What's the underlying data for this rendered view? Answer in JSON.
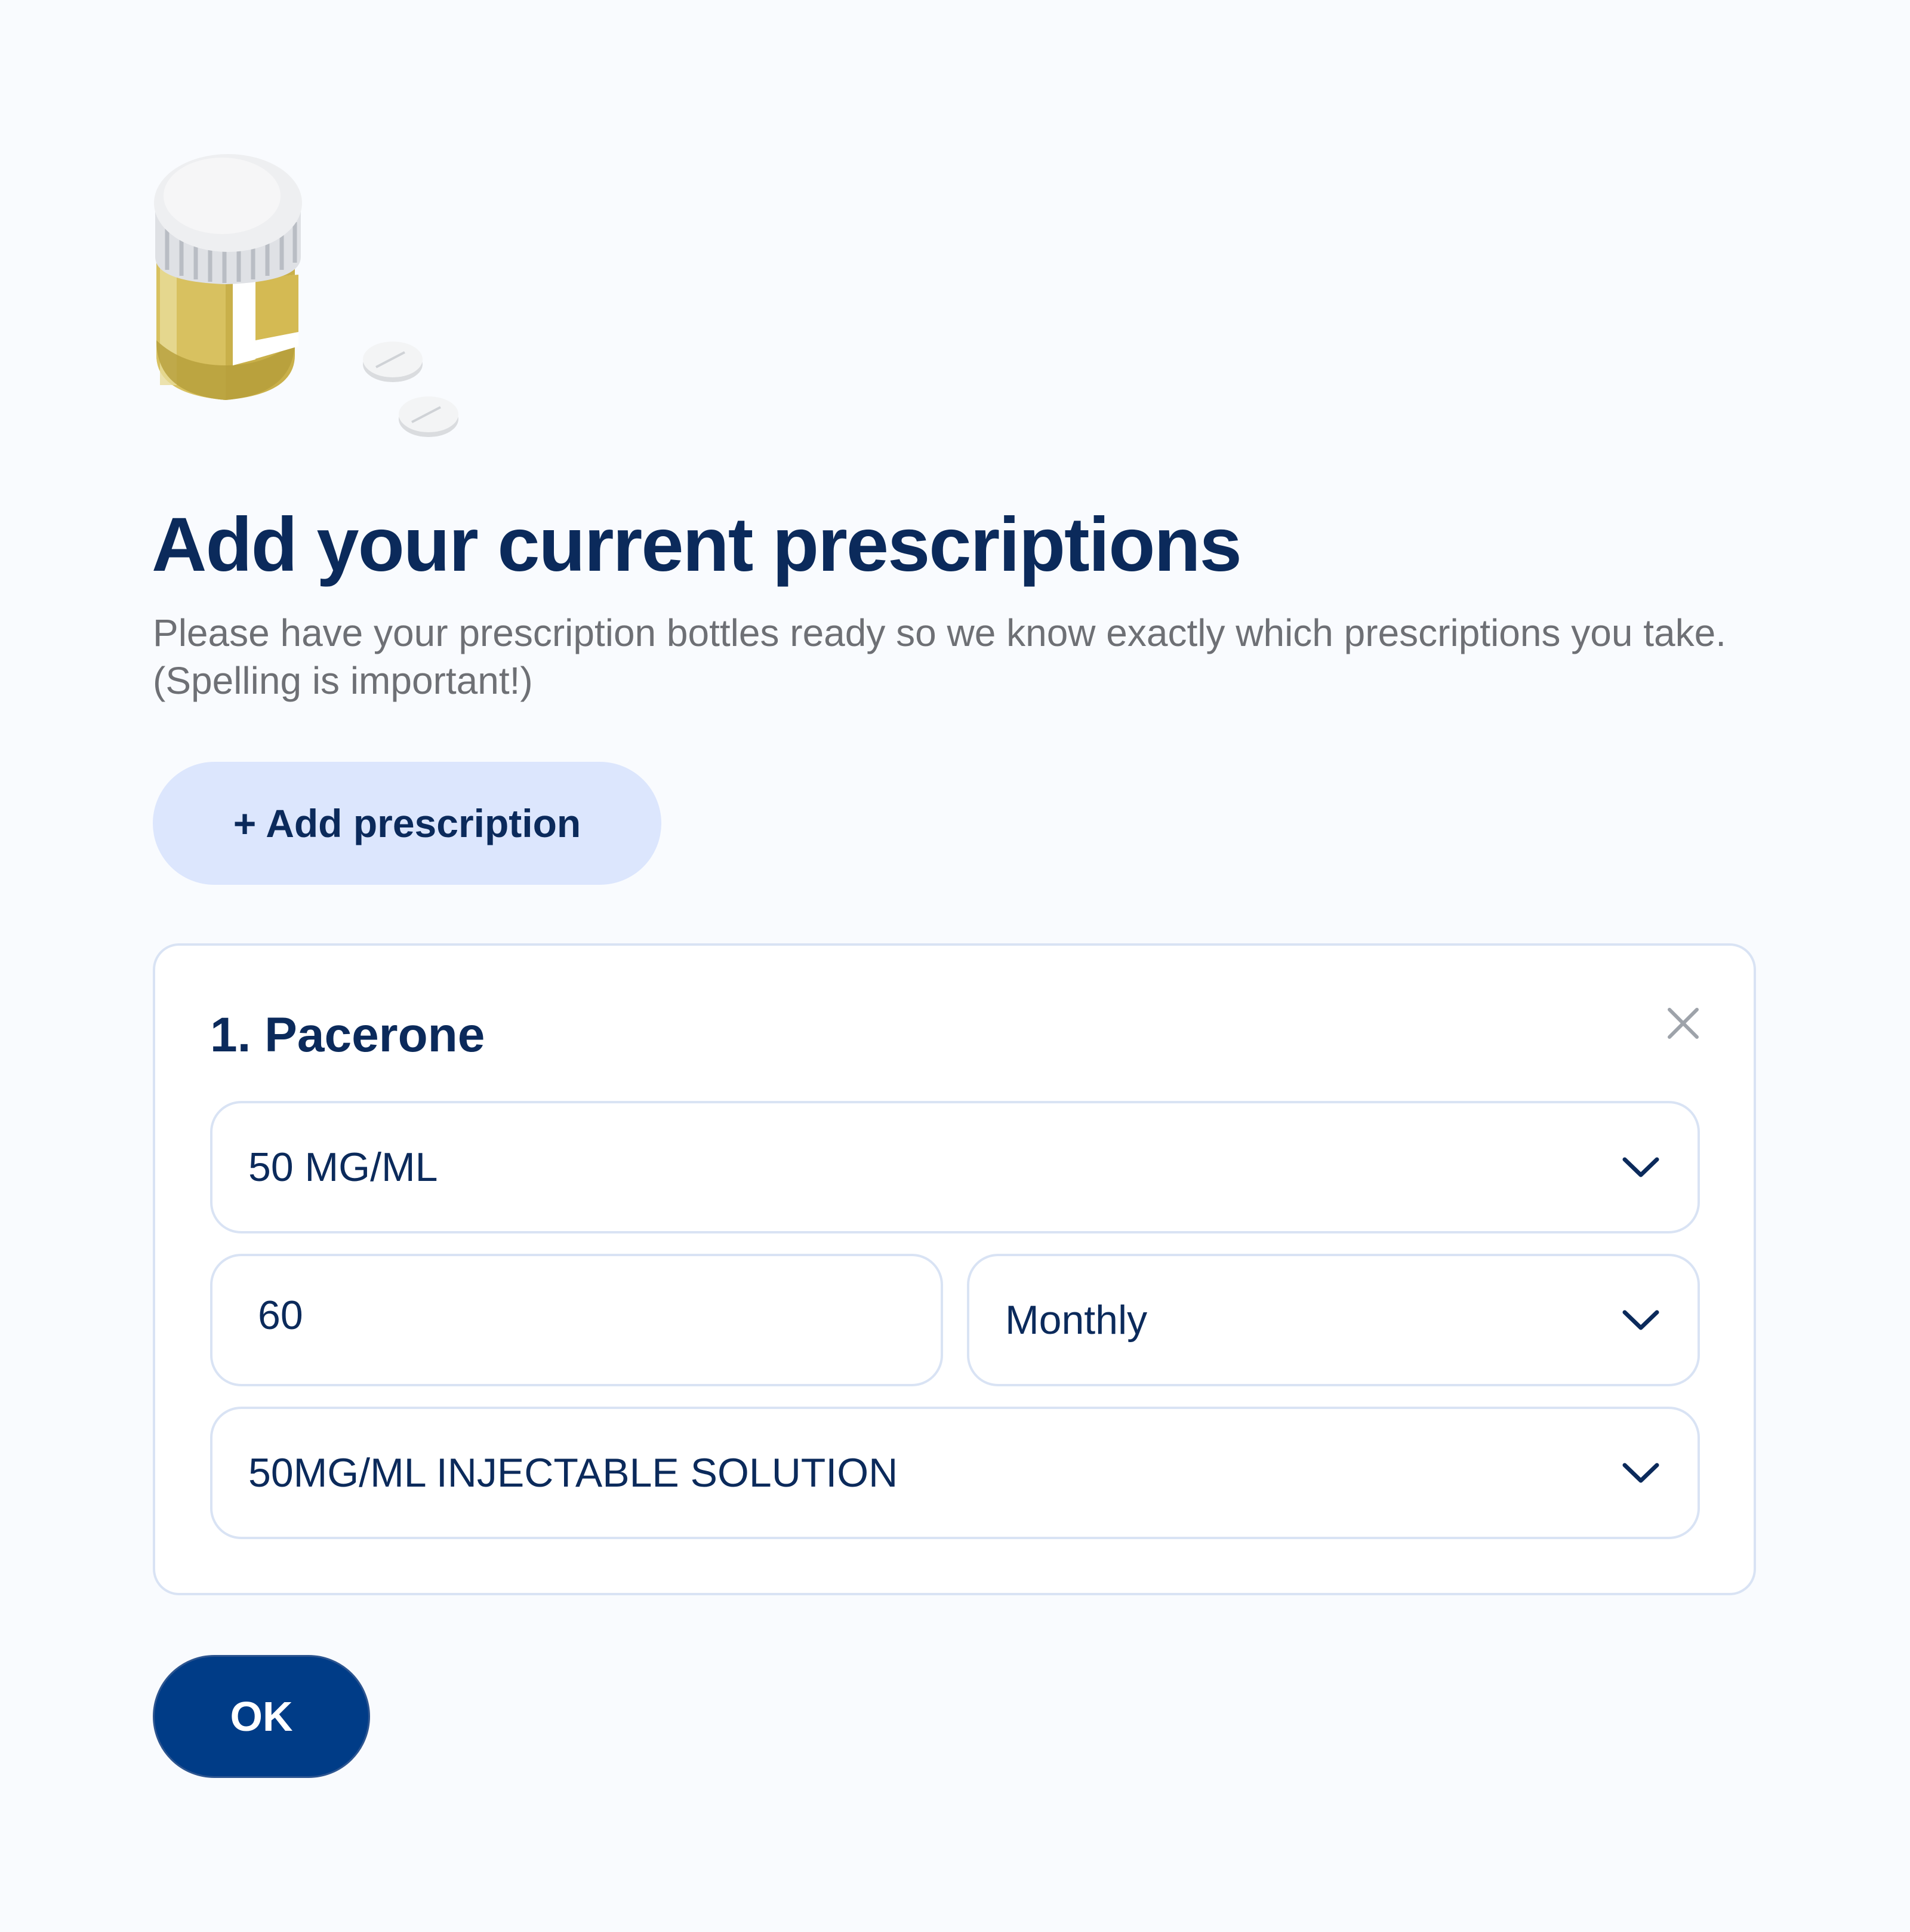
{
  "header": {
    "illustration": "pill-bottle-illustration",
    "title": "Add your current prescriptions",
    "subtitle": "Please have your prescription bottles ready so we know exactly which prescriptions you take. (Spelling is important!)"
  },
  "add_button": {
    "label": "+ Add prescription"
  },
  "prescription": {
    "title": "1. Pacerone",
    "close_icon": "close-icon",
    "strength": "50 MG/ML",
    "quantity": "60",
    "frequency": "Monthly",
    "form": "50MG/ML INJECTABLE SOLUTION"
  },
  "ok_button": {
    "label": "OK"
  },
  "colors": {
    "background": "#f9fbfe",
    "primary_text": "#0b2a5b",
    "muted_text": "#6e7075",
    "secondary_button": "#dce6fd",
    "primary_button": "#003c87",
    "border": "#d9e3f4"
  }
}
